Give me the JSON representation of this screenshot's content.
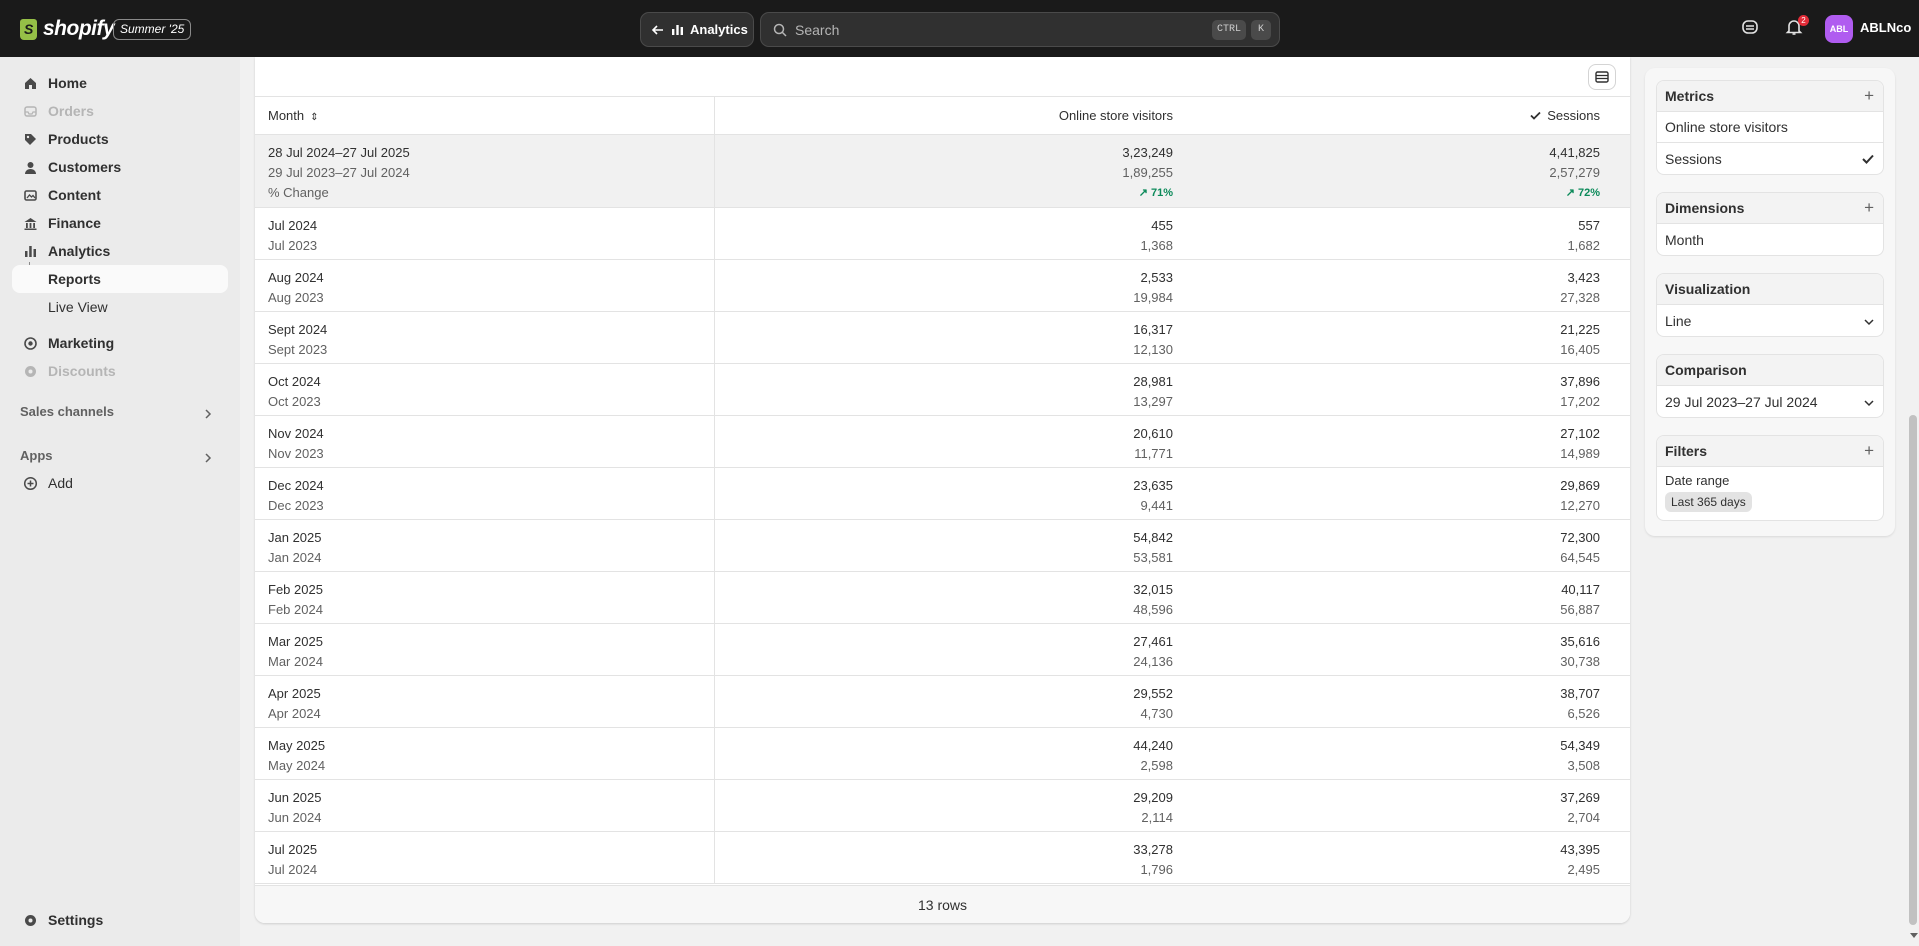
{
  "topbar": {
    "brand": "shopify",
    "edition_badge": "Summer '25",
    "back_label": "Analytics",
    "search_placeholder": "Search",
    "shortcut_ctrl": "CTRL",
    "shortcut_k": "K",
    "notification_count": "2",
    "avatar_initials": "ABL",
    "store_name": "ABLNco"
  },
  "sidebar": {
    "items": [
      {
        "label": "Home",
        "icon": "home-icon",
        "disabled": false
      },
      {
        "label": "Orders",
        "icon": "inbox-icon",
        "disabled": true
      },
      {
        "label": "Products",
        "icon": "tag-icon",
        "disabled": false
      },
      {
        "label": "Customers",
        "icon": "person-icon",
        "disabled": false
      },
      {
        "label": "Content",
        "icon": "image-icon",
        "disabled": false
      },
      {
        "label": "Finance",
        "icon": "bank-icon",
        "disabled": false
      },
      {
        "label": "Analytics",
        "icon": "chart-icon",
        "disabled": false
      }
    ],
    "sub_items": [
      {
        "label": "Reports",
        "active": true
      },
      {
        "label": "Live View",
        "active": false
      }
    ],
    "items2": [
      {
        "label": "Marketing",
        "icon": "target-icon",
        "disabled": false
      },
      {
        "label": "Discounts",
        "icon": "gear-icon",
        "disabled": true
      }
    ],
    "sales_channels": "Sales channels",
    "apps": "Apps",
    "add": "Add",
    "settings": "Settings"
  },
  "table": {
    "headers": {
      "month": "Month",
      "visitors": "Online store visitors",
      "sessions": "Sessions"
    },
    "summary": {
      "period": "28 Jul 2024–27 Jul 2025",
      "compare_period": "29 Jul 2023–27 Jul 2024",
      "change_label": "% Change",
      "visitors": "3,23,249",
      "visitors_prev": "1,89,255",
      "visitors_change": "71%",
      "sessions": "4,41,825",
      "sessions_prev": "2,57,279",
      "sessions_change": "72%"
    },
    "rows": [
      {
        "month": "Jul 2024",
        "prev_month": "Jul 2023",
        "visitors": "455",
        "visitors_prev": "1,368",
        "sessions": "557",
        "sessions_prev": "1,682"
      },
      {
        "month": "Aug 2024",
        "prev_month": "Aug 2023",
        "visitors": "2,533",
        "visitors_prev": "19,984",
        "sessions": "3,423",
        "sessions_prev": "27,328"
      },
      {
        "month": "Sept 2024",
        "prev_month": "Sept 2023",
        "visitors": "16,317",
        "visitors_prev": "12,130",
        "sessions": "21,225",
        "sessions_prev": "16,405"
      },
      {
        "month": "Oct 2024",
        "prev_month": "Oct 2023",
        "visitors": "28,981",
        "visitors_prev": "13,297",
        "sessions": "37,896",
        "sessions_prev": "17,202"
      },
      {
        "month": "Nov 2024",
        "prev_month": "Nov 2023",
        "visitors": "20,610",
        "visitors_prev": "11,771",
        "sessions": "27,102",
        "sessions_prev": "14,989"
      },
      {
        "month": "Dec 2024",
        "prev_month": "Dec 2023",
        "visitors": "23,635",
        "visitors_prev": "9,441",
        "sessions": "29,869",
        "sessions_prev": "12,270"
      },
      {
        "month": "Jan 2025",
        "prev_month": "Jan 2024",
        "visitors": "54,842",
        "visitors_prev": "53,581",
        "sessions": "72,300",
        "sessions_prev": "64,545"
      },
      {
        "month": "Feb 2025",
        "prev_month": "Feb 2024",
        "visitors": "32,015",
        "visitors_prev": "48,596",
        "sessions": "40,117",
        "sessions_prev": "56,887"
      },
      {
        "month": "Mar 2025",
        "prev_month": "Mar 2024",
        "visitors": "27,461",
        "visitors_prev": "24,136",
        "sessions": "35,616",
        "sessions_prev": "30,738"
      },
      {
        "month": "Apr 2025",
        "prev_month": "Apr 2024",
        "visitors": "29,552",
        "visitors_prev": "4,730",
        "sessions": "38,707",
        "sessions_prev": "6,526"
      },
      {
        "month": "May 2025",
        "prev_month": "May 2024",
        "visitors": "44,240",
        "visitors_prev": "2,598",
        "sessions": "54,349",
        "sessions_prev": "3,508"
      },
      {
        "month": "Jun 2025",
        "prev_month": "Jun 2024",
        "visitors": "29,209",
        "visitors_prev": "2,114",
        "sessions": "37,269",
        "sessions_prev": "2,704"
      },
      {
        "month": "Jul 2025",
        "prev_month": "Jul 2024",
        "visitors": "33,278",
        "visitors_prev": "1,796",
        "sessions": "43,395",
        "sessions_prev": "2,495"
      }
    ],
    "footer": "13 rows"
  },
  "panel": {
    "metrics": {
      "title": "Metrics",
      "items": [
        "Online store visitors",
        "Sessions"
      ]
    },
    "dimensions": {
      "title": "Dimensions",
      "items": [
        "Month"
      ]
    },
    "visualization": {
      "title": "Visualization",
      "value": "Line"
    },
    "comparison": {
      "title": "Comparison",
      "value": "29 Jul 2023–27 Jul 2024"
    },
    "filters": {
      "title": "Filters",
      "label": "Date range",
      "chip": "Last 365 days"
    }
  },
  "colors": {
    "topbar": "#1a1a1a",
    "positive": "#0c8a5a",
    "avatar": "#b05cf0",
    "badge": "#e22c38"
  }
}
